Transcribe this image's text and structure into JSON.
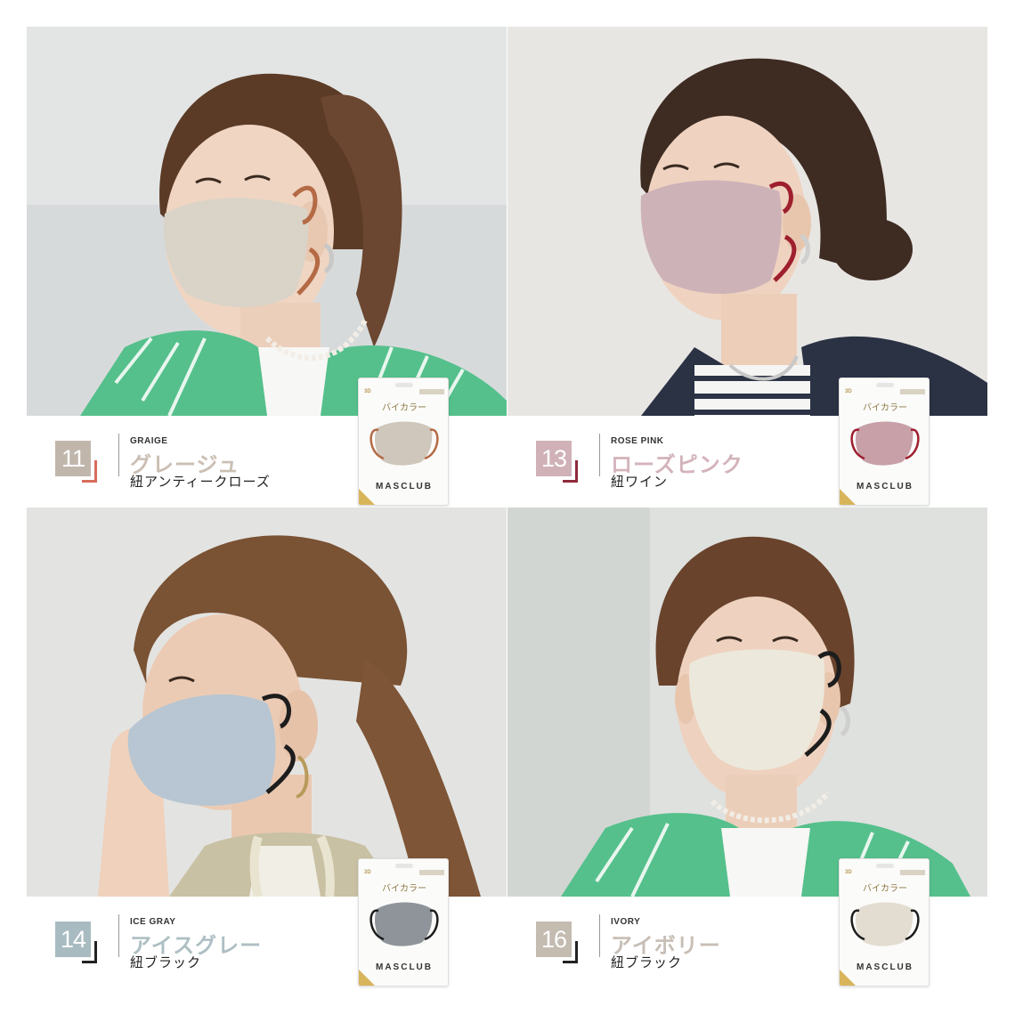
{
  "products": [
    {
      "number": "11",
      "name_en": "GRAIGE",
      "name_jp": "グレージュ",
      "strap": "紐アンティークローズ",
      "colors": {
        "text": "#cbbfb3",
        "box": "#c1b6ab",
        "accent": "#d86c5a",
        "mask": "#d9d3c8",
        "strap": "#b46a45",
        "bg": "#d7dadb",
        "pack_mask": "#cfc7bb"
      },
      "package": {
        "badge": "3D",
        "title": "バイカラー",
        "brand": "MASCLUB"
      }
    },
    {
      "number": "13",
      "name_en": "ROSE PINK",
      "name_jp": "ローズピンク",
      "strap": "紐ワイン",
      "colors": {
        "text": "#d4b3bb",
        "box": "#d0b1b8",
        "accent": "#8e2a3d",
        "mask": "#cdb3b8",
        "strap": "#9e1f2e",
        "bg": "#e8e6e3",
        "pack_mask": "#c7a0a8"
      },
      "package": {
        "badge": "3D",
        "title": "バイカラー",
        "brand": "MASCLUB"
      }
    },
    {
      "number": "14",
      "name_en": "ICE GRAY",
      "name_jp": "アイスグレー",
      "strap": "紐ブラック",
      "colors": {
        "text": "#aebfc4",
        "box": "#a8bbc0",
        "accent": "#222222",
        "mask": "#b7c6d2",
        "strap": "#1d1d1d",
        "bg": "#e3e4e2",
        "pack_mask": "#8e9499"
      },
      "package": {
        "badge": "3D",
        "title": "バイカラー",
        "brand": "MASCLUB"
      }
    },
    {
      "number": "16",
      "name_en": "IVORY",
      "name_jp": "アイボリー",
      "strap": "紐ブラック",
      "colors": {
        "text": "#c7beb5",
        "box": "#c4bbb1",
        "accent": "#222222",
        "mask": "#ece8dc",
        "strap": "#1d1d1d",
        "bg": "#dfe1de",
        "pack_mask": "#e2ddd0"
      },
      "package": {
        "badge": "3D",
        "title": "バイカラー",
        "brand": "MASCLUB"
      }
    }
  ]
}
